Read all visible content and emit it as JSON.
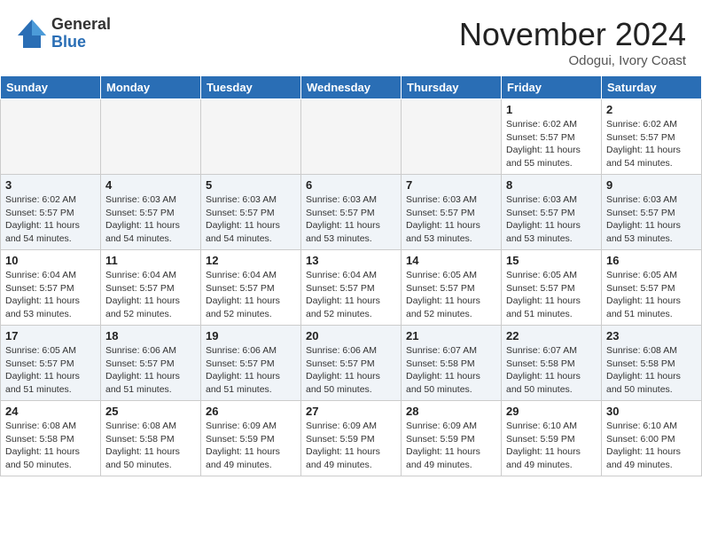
{
  "header": {
    "logo_general": "General",
    "logo_blue": "Blue",
    "month_title": "November 2024",
    "location": "Odogui, Ivory Coast"
  },
  "days_of_week": [
    "Sunday",
    "Monday",
    "Tuesday",
    "Wednesday",
    "Thursday",
    "Friday",
    "Saturday"
  ],
  "weeks": [
    [
      {
        "day": "",
        "empty": true
      },
      {
        "day": "",
        "empty": true
      },
      {
        "day": "",
        "empty": true
      },
      {
        "day": "",
        "empty": true
      },
      {
        "day": "",
        "empty": true
      },
      {
        "day": "1",
        "sunrise": "6:02 AM",
        "sunset": "5:57 PM",
        "daylight": "11 hours and 55 minutes."
      },
      {
        "day": "2",
        "sunrise": "6:02 AM",
        "sunset": "5:57 PM",
        "daylight": "11 hours and 54 minutes."
      }
    ],
    [
      {
        "day": "3",
        "sunrise": "6:02 AM",
        "sunset": "5:57 PM",
        "daylight": "11 hours and 54 minutes."
      },
      {
        "day": "4",
        "sunrise": "6:03 AM",
        "sunset": "5:57 PM",
        "daylight": "11 hours and 54 minutes."
      },
      {
        "day": "5",
        "sunrise": "6:03 AM",
        "sunset": "5:57 PM",
        "daylight": "11 hours and 54 minutes."
      },
      {
        "day": "6",
        "sunrise": "6:03 AM",
        "sunset": "5:57 PM",
        "daylight": "11 hours and 53 minutes."
      },
      {
        "day": "7",
        "sunrise": "6:03 AM",
        "sunset": "5:57 PM",
        "daylight": "11 hours and 53 minutes."
      },
      {
        "day": "8",
        "sunrise": "6:03 AM",
        "sunset": "5:57 PM",
        "daylight": "11 hours and 53 minutes."
      },
      {
        "day": "9",
        "sunrise": "6:03 AM",
        "sunset": "5:57 PM",
        "daylight": "11 hours and 53 minutes."
      }
    ],
    [
      {
        "day": "10",
        "sunrise": "6:04 AM",
        "sunset": "5:57 PM",
        "daylight": "11 hours and 53 minutes."
      },
      {
        "day": "11",
        "sunrise": "6:04 AM",
        "sunset": "5:57 PM",
        "daylight": "11 hours and 52 minutes."
      },
      {
        "day": "12",
        "sunrise": "6:04 AM",
        "sunset": "5:57 PM",
        "daylight": "11 hours and 52 minutes."
      },
      {
        "day": "13",
        "sunrise": "6:04 AM",
        "sunset": "5:57 PM",
        "daylight": "11 hours and 52 minutes."
      },
      {
        "day": "14",
        "sunrise": "6:05 AM",
        "sunset": "5:57 PM",
        "daylight": "11 hours and 52 minutes."
      },
      {
        "day": "15",
        "sunrise": "6:05 AM",
        "sunset": "5:57 PM",
        "daylight": "11 hours and 51 minutes."
      },
      {
        "day": "16",
        "sunrise": "6:05 AM",
        "sunset": "5:57 PM",
        "daylight": "11 hours and 51 minutes."
      }
    ],
    [
      {
        "day": "17",
        "sunrise": "6:05 AM",
        "sunset": "5:57 PM",
        "daylight": "11 hours and 51 minutes."
      },
      {
        "day": "18",
        "sunrise": "6:06 AM",
        "sunset": "5:57 PM",
        "daylight": "11 hours and 51 minutes."
      },
      {
        "day": "19",
        "sunrise": "6:06 AM",
        "sunset": "5:57 PM",
        "daylight": "11 hours and 51 minutes."
      },
      {
        "day": "20",
        "sunrise": "6:06 AM",
        "sunset": "5:57 PM",
        "daylight": "11 hours and 50 minutes."
      },
      {
        "day": "21",
        "sunrise": "6:07 AM",
        "sunset": "5:58 PM",
        "daylight": "11 hours and 50 minutes."
      },
      {
        "day": "22",
        "sunrise": "6:07 AM",
        "sunset": "5:58 PM",
        "daylight": "11 hours and 50 minutes."
      },
      {
        "day": "23",
        "sunrise": "6:08 AM",
        "sunset": "5:58 PM",
        "daylight": "11 hours and 50 minutes."
      }
    ],
    [
      {
        "day": "24",
        "sunrise": "6:08 AM",
        "sunset": "5:58 PM",
        "daylight": "11 hours and 50 minutes."
      },
      {
        "day": "25",
        "sunrise": "6:08 AM",
        "sunset": "5:58 PM",
        "daylight": "11 hours and 50 minutes."
      },
      {
        "day": "26",
        "sunrise": "6:09 AM",
        "sunset": "5:59 PM",
        "daylight": "11 hours and 49 minutes."
      },
      {
        "day": "27",
        "sunrise": "6:09 AM",
        "sunset": "5:59 PM",
        "daylight": "11 hours and 49 minutes."
      },
      {
        "day": "28",
        "sunrise": "6:09 AM",
        "sunset": "5:59 PM",
        "daylight": "11 hours and 49 minutes."
      },
      {
        "day": "29",
        "sunrise": "6:10 AM",
        "sunset": "5:59 PM",
        "daylight": "11 hours and 49 minutes."
      },
      {
        "day": "30",
        "sunrise": "6:10 AM",
        "sunset": "6:00 PM",
        "daylight": "11 hours and 49 minutes."
      }
    ]
  ],
  "labels": {
    "sunrise": "Sunrise: ",
    "sunset": "Sunset: ",
    "daylight": "Daylight: "
  }
}
